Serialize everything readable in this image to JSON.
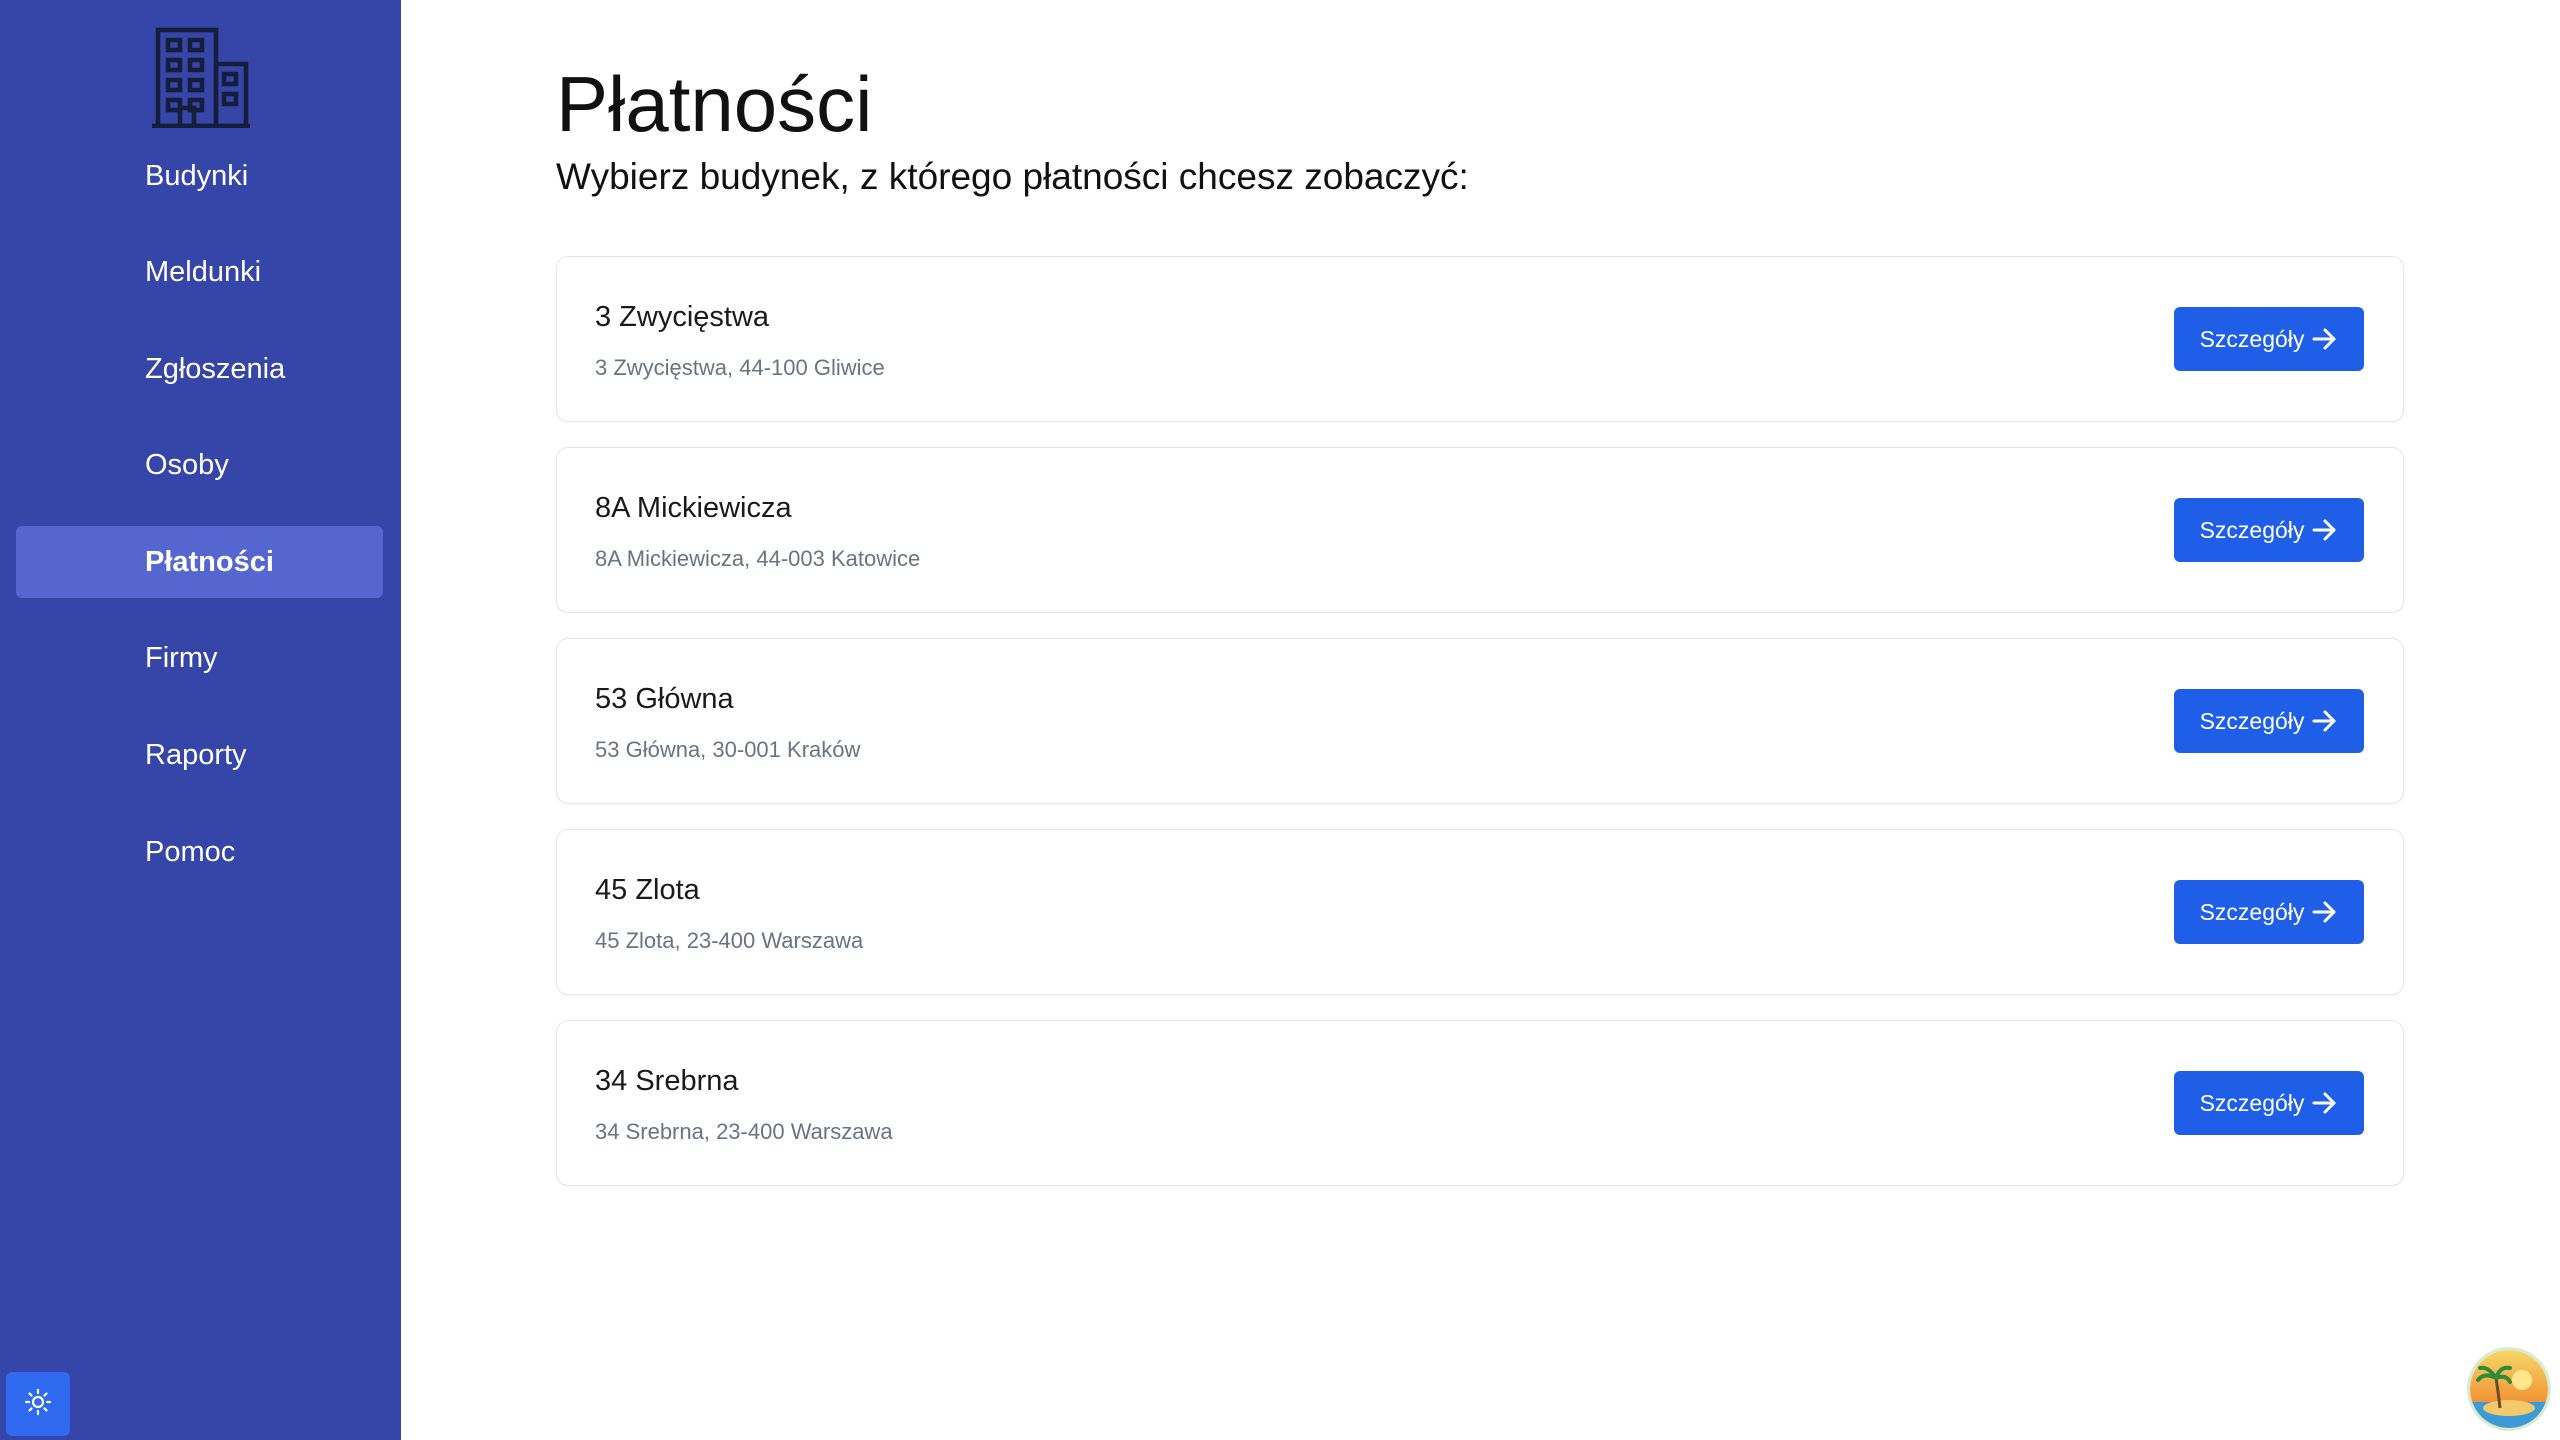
{
  "sidebar": {
    "logo_icon": "building-icon",
    "items": [
      {
        "label": "Budynki",
        "active": false
      },
      {
        "label": "Meldunki",
        "active": false
      },
      {
        "label": "Zgłoszenia",
        "active": false
      },
      {
        "label": "Osoby",
        "active": false
      },
      {
        "label": "Płatności",
        "active": true
      },
      {
        "label": "Firmy",
        "active": false
      },
      {
        "label": "Raporty",
        "active": false
      },
      {
        "label": "Pomoc",
        "active": false
      }
    ],
    "theme_toggle_icon": "sun-icon"
  },
  "main": {
    "title": "Płatności",
    "subtitle": "Wybierz budynek, z którego płatności chcesz zobaczyć:",
    "buildings": [
      {
        "name": "3 Zwycięstwa",
        "address": "3 Zwycięstwa, 44-100 Gliwice",
        "button_label": "Szczegóły"
      },
      {
        "name": "8A Mickiewicza",
        "address": "8A Mickiewicza, 44-003 Katowice",
        "button_label": "Szczegóły"
      },
      {
        "name": "53 Główna",
        "address": "53 Główna, 30-001 Kraków",
        "button_label": "Szczegóły"
      },
      {
        "name": "45 Zlota",
        "address": "45 Zlota, 23-400 Warszawa",
        "button_label": "Szczegóły"
      },
      {
        "name": "34 Srebrna",
        "address": "34 Srebrna, 23-400 Warszawa",
        "button_label": "Szczegóły"
      }
    ]
  },
  "colors": {
    "sidebar_bg": "#3545a8",
    "sidebar_active_bg": "#5566d1",
    "button_bg": "#1f5fe8",
    "card_border": "#e3e6ea",
    "address_text": "#6b7280"
  },
  "avatar_icon": "palm-beach-avatar-icon"
}
